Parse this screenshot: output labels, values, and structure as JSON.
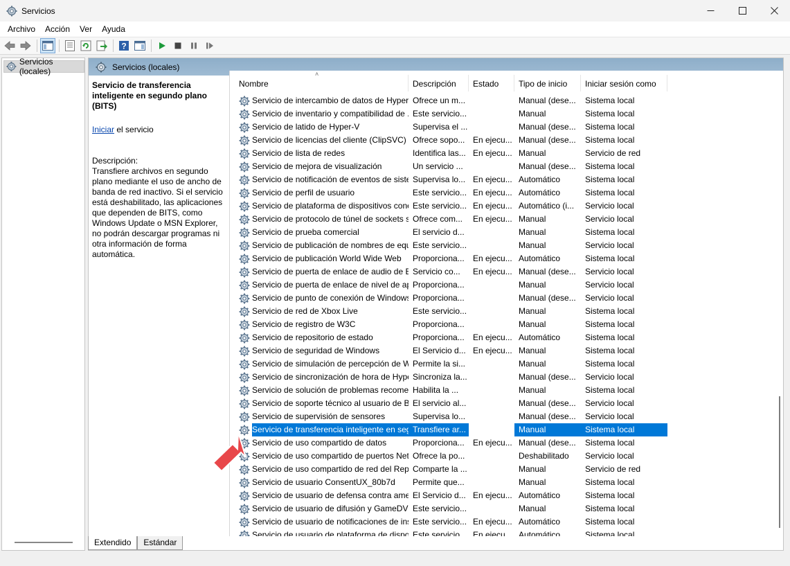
{
  "window": {
    "title": "Servicios"
  },
  "menu": [
    "Archivo",
    "Acción",
    "Ver",
    "Ayuda"
  ],
  "tree": {
    "root": "Servicios (locales)"
  },
  "header": {
    "title": "Servicios (locales)"
  },
  "details": {
    "service_title": "Servicio de transferencia inteligente en segundo plano (BITS)",
    "action_link": "Iniciar",
    "action_suffix": " el servicio",
    "description_label": "Descripción:",
    "description": "Transfiere archivos en segundo plano mediante el uso de ancho de banda de red inactivo. Si el servicio está deshabilitado, las aplicaciones que dependen de BITS, como Windows Update o MSN Explorer, no podrán descargar programas ni otra información de forma automática."
  },
  "columns": [
    "Nombre",
    "Descripción",
    "Estado",
    "Tipo de inicio",
    "Iniciar sesión como"
  ],
  "rows": [
    [
      "Servicio de intercambio de datos de Hyper-V",
      "Ofrece un m...",
      "",
      "Manual (dese...",
      "Sistema local"
    ],
    [
      "Servicio de inventario y compatibilidad de ...",
      "Este servicio...",
      "",
      "Manual",
      "Sistema local"
    ],
    [
      "Servicio de latido de Hyper-V",
      "Supervisa el ...",
      "",
      "Manual (dese...",
      "Sistema local"
    ],
    [
      "Servicio de licencias del cliente (ClipSVC)",
      "Ofrece sopo...",
      "En ejecu...",
      "Manual (dese...",
      "Sistema local"
    ],
    [
      "Servicio de lista de redes",
      "Identifica las...",
      "En ejecu...",
      "Manual",
      "Servicio de red"
    ],
    [
      "Servicio de mejora de visualización",
      "Un servicio ...",
      "",
      "Manual (dese...",
      "Sistema local"
    ],
    [
      "Servicio de notificación de eventos de siste...",
      "Supervisa lo...",
      "En ejecu...",
      "Automático",
      "Sistema local"
    ],
    [
      "Servicio de perfil de usuario",
      "Este servicio...",
      "En ejecu...",
      "Automático",
      "Sistema local"
    ],
    [
      "Servicio de plataforma de dispositivos cone...",
      "Este servicio...",
      "En ejecu...",
      "Automático (i...",
      "Servicio local"
    ],
    [
      "Servicio de protocolo de túnel de sockets s...",
      "Ofrece com...",
      "En ejecu...",
      "Manual",
      "Servicio local"
    ],
    [
      "Servicio de prueba comercial",
      "El servicio d...",
      "",
      "Manual",
      "Sistema local"
    ],
    [
      "Servicio de publicación de nombres de equ...",
      "Este servicio...",
      "",
      "Manual",
      "Servicio local"
    ],
    [
      "Servicio de publicación World Wide Web",
      "Proporciona...",
      "En ejecu...",
      "Automático",
      "Sistema local"
    ],
    [
      "Servicio de puerta de enlace de audio de Bl...",
      "Servicio co...",
      "En ejecu...",
      "Manual (dese...",
      "Servicio local"
    ],
    [
      "Servicio de puerta de enlace de nivel de apl...",
      "Proporciona...",
      "",
      "Manual",
      "Servicio local"
    ],
    [
      "Servicio de punto de conexión de Windows...",
      "Proporciona...",
      "",
      "Manual (dese...",
      "Servicio local"
    ],
    [
      "Servicio de red de Xbox Live",
      "Este servicio...",
      "",
      "Manual",
      "Sistema local"
    ],
    [
      "Servicio de registro de W3C",
      "Proporciona...",
      "",
      "Manual",
      "Sistema local"
    ],
    [
      "Servicio de repositorio de estado",
      "Proporciona...",
      "En ejecu...",
      "Automático",
      "Sistema local"
    ],
    [
      "Servicio de seguridad de Windows",
      "El Servicio d...",
      "En ejecu...",
      "Manual",
      "Sistema local"
    ],
    [
      "Servicio de simulación de percepción de W...",
      "Permite la si...",
      "",
      "Manual",
      "Sistema local"
    ],
    [
      "Servicio de sincronización de hora de Hype...",
      "Sincroniza la...",
      "",
      "Manual (dese...",
      "Servicio local"
    ],
    [
      "Servicio de solución de problemas recome...",
      "Habilita la ...",
      "",
      "Manual",
      "Sistema local"
    ],
    [
      "Servicio de soporte técnico al usuario de Bl...",
      "El servicio al...",
      "",
      "Manual (dese...",
      "Servicio local"
    ],
    [
      "Servicio de supervisión de sensores",
      "Supervisa lo...",
      "",
      "Manual (dese...",
      "Servicio local"
    ],
    [
      "Servicio de transferencia inteligente en seg...",
      "Transfiere ar...",
      "",
      "Manual",
      "Sistema local"
    ],
    [
      "Servicio de uso compartido de datos",
      "Proporciona...",
      "En ejecu...",
      "Manual (dese...",
      "Sistema local"
    ],
    [
      "Servicio de uso compartido de puertos Net....",
      "Ofrece la po...",
      "",
      "Deshabilitado",
      "Servicio local"
    ],
    [
      "Servicio de uso compartido de red del Repr...",
      "Comparte la ...",
      "",
      "Manual",
      "Servicio de red"
    ],
    [
      "Servicio de usuario ConsentUX_80b7d",
      "Permite que...",
      "",
      "Manual",
      "Sistema local"
    ],
    [
      "Servicio de usuario de defensa contra ame...",
      "El Servicio d...",
      "En ejecu...",
      "Automático",
      "Sistema local"
    ],
    [
      "Servicio de usuario de difusión y GameDVR...",
      "Este servicio...",
      "",
      "Manual",
      "Sistema local"
    ],
    [
      "Servicio de usuario de notificaciones de ins...",
      "Este servicio...",
      "En ejecu...",
      "Automático",
      "Sistema local"
    ],
    [
      "Servicio de usuario de plataforma de dispo...",
      "Este servicio...",
      "En ejecu...",
      "Automático",
      "Sistema local"
    ]
  ],
  "selected_row": 25,
  "tabs": [
    "Extendido",
    "Estándar"
  ],
  "active_tab": 0,
  "colors": {
    "selection": "#0078d7",
    "header_band": "#9fbbd3",
    "annotation_arrow": "#e8474a"
  }
}
